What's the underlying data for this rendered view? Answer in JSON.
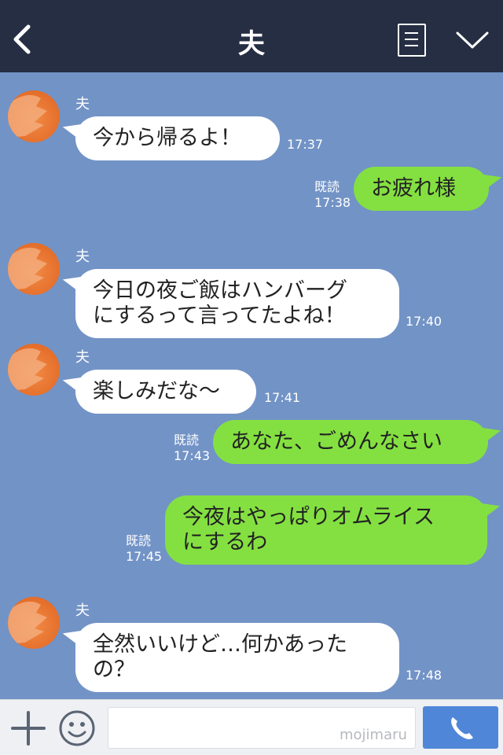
{
  "header": {
    "title": "夫",
    "back_icon": "chevron-left-icon",
    "menu_icon": "list-icon",
    "collapse_icon": "chevron-down-icon"
  },
  "messages": [
    {
      "from": "夫",
      "side": "left",
      "lines": [
        "今から帰るよ！"
      ],
      "time": "17:37"
    },
    {
      "side": "right",
      "lines": [
        "お疲れ様"
      ],
      "read": "既読",
      "time": "17:38"
    },
    {
      "from": "夫",
      "side": "left",
      "lines": [
        "今日の夜ご飯はハンバーグ",
        "にするって言ってたよね！"
      ],
      "time": "17:40"
    },
    {
      "from": "夫",
      "side": "left",
      "lines": [
        "楽しみだな〜"
      ],
      "time": "17:41"
    },
    {
      "side": "right",
      "lines": [
        "あなた、ごめんなさい"
      ],
      "read": "既読",
      "time": "17:43"
    },
    {
      "side": "right",
      "lines": [
        "今夜はやっぱりオムライス",
        "にするわ"
      ],
      "read": "既読",
      "time": "17:45"
    },
    {
      "from": "夫",
      "side": "left",
      "lines": [
        "全然いいけど…何かあった",
        "の？"
      ],
      "time": "17:48"
    }
  ],
  "input": {
    "value": "",
    "watermark": "mojimaru"
  },
  "icons": {
    "plus": "plus-icon",
    "emoji": "smiley-icon",
    "call": "phone-icon"
  },
  "colors": {
    "header_bg": "#252e42",
    "chat_bg": "#7293c6",
    "left_bubble": "#ffffff",
    "right_bubble": "#84e041",
    "call_button": "#4f86d8"
  }
}
